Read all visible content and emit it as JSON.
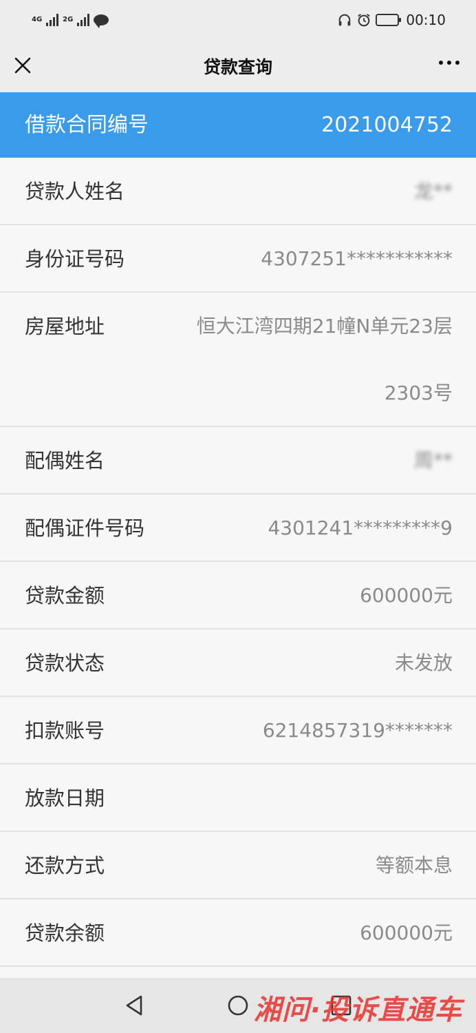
{
  "status_bar": {
    "net1": "4G",
    "net2": "2G",
    "time": "00:10"
  },
  "nav": {
    "title": "贷款查询"
  },
  "header_row": {
    "label": "借款合同编号",
    "value": "2021004752"
  },
  "rows": [
    {
      "label": "贷款人姓名",
      "value": "龙**"
    },
    {
      "label": "身份证号码",
      "value": "4307251***********"
    },
    {
      "label": "房屋地址",
      "value": "恒大江湾四期21幢N单元23层2303号"
    },
    {
      "label": "配偶姓名",
      "value": "周**"
    },
    {
      "label": "配偶证件号码",
      "value": "4301241*********9"
    },
    {
      "label": "贷款金额",
      "value": "600000元"
    },
    {
      "label": "贷款状态",
      "value": "未发放"
    },
    {
      "label": "扣款账号",
      "value": "6214857319*******"
    },
    {
      "label": "放款日期",
      "value": ""
    },
    {
      "label": "还款方式",
      "value": "等额本息"
    },
    {
      "label": "贷款余额",
      "value": "600000元"
    }
  ],
  "watermark": "湘问·投诉直通车",
  "colors": {
    "accent": "#3a9bea",
    "watermark": "#e8322e"
  }
}
